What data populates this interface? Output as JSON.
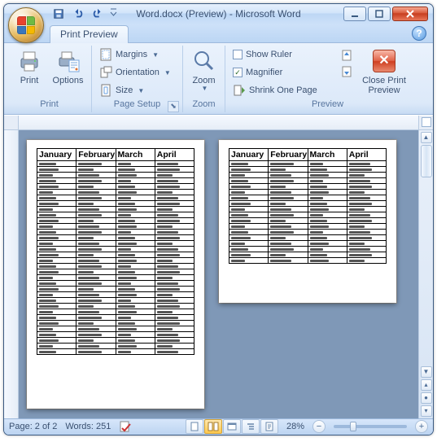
{
  "window": {
    "title": "Word.docx (Preview) - Microsoft Word"
  },
  "qat": {
    "save": "Save",
    "undo": "Undo",
    "redo": "Redo"
  },
  "tabs": {
    "active": "Print Preview"
  },
  "ribbon": {
    "print_group": "Print",
    "print": "Print",
    "options": "Options",
    "pagesetup_group": "Page Setup",
    "margins": "Margins",
    "orientation": "Orientation",
    "size": "Size",
    "zoom_group": "Zoom",
    "zoom": "Zoom",
    "preview_group": "Preview",
    "show_ruler": "Show Ruler",
    "show_ruler_checked": false,
    "magnifier": "Magnifier",
    "magnifier_checked": true,
    "shrink": "Shrink One Page",
    "nextpage": "Next Page",
    "prevpage": "Previous Page",
    "close": "Close Print Preview"
  },
  "doc": {
    "headers": [
      "January",
      "February",
      "March",
      "April"
    ],
    "page1_rows": 34,
    "page2_rows": 18
  },
  "status": {
    "page": "Page: 2 of 2",
    "words": "Words: 251",
    "zoom": "28%"
  }
}
